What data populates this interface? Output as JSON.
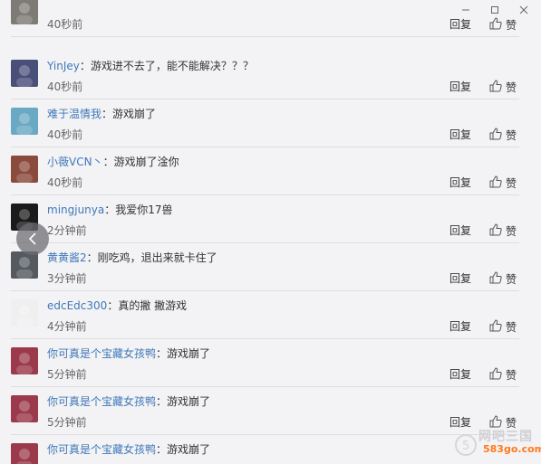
{
  "window": {
    "minimize_icon": "minimize-icon",
    "maximize_icon": "maximize-icon",
    "close_icon": "close-icon"
  },
  "actions": {
    "reply_label": "回复",
    "like_label": "赞"
  },
  "comments": [
    {
      "user": "",
      "text": "",
      "time": "40秒前",
      "avatar_color": "#7e7a76"
    },
    {
      "user": "YinJey",
      "text": "游戏进不去了，能不能解决？？？",
      "time": "40秒前",
      "avatar_color": "#4a4f7a"
    },
    {
      "user": "难于温情我",
      "text": "游戏崩了",
      "time": "40秒前",
      "avatar_color": "#6aa9c4"
    },
    {
      "user": "小薇VCN丶",
      "text": "游戏崩了淦你",
      "time": "40秒前",
      "avatar_color": "#8a4a3c"
    },
    {
      "user": "mingjunya",
      "text": "我爱你17兽",
      "time": "2分钟前",
      "avatar_color": "#1a1a1a"
    },
    {
      "user": "黄黄酱2",
      "text": "刚吃鸡，退出来就卡住了",
      "time": "3分钟前",
      "avatar_color": "#555a60"
    },
    {
      "user": "edcEdc300",
      "text": "真的撇 撇游戏",
      "time": "4分钟前",
      "avatar_color": "#efefef"
    },
    {
      "user": "你可真是个宝藏女孩鸭",
      "text": "游戏崩了",
      "time": "5分钟前",
      "avatar_color": "#9b3a4a"
    },
    {
      "user": "你可真是个宝藏女孩鸭",
      "text": "游戏崩了",
      "time": "5分钟前",
      "avatar_color": "#9b3a4a"
    },
    {
      "user": "你可真是个宝藏女孩鸭",
      "text": "游戏崩了",
      "time": "",
      "avatar_color": "#9b3a4a"
    }
  ],
  "watermark": {
    "line1": "网吧三国",
    "line2": "583go.com"
  }
}
